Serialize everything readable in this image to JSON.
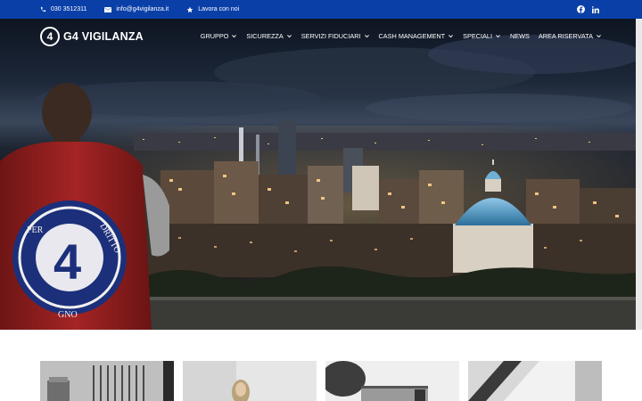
{
  "topbar": {
    "phone": "030 3512311",
    "email": "info@g4vigilanza.it",
    "jobs": "Lavora con noi",
    "social": [
      "facebook-icon",
      "linkedin-icon"
    ]
  },
  "header": {
    "logo_text": "G4 VIGILANZA",
    "nav": [
      {
        "label": "GRUPPO",
        "dropdown": true
      },
      {
        "label": "SICUREZZA",
        "dropdown": true
      },
      {
        "label": "SERVIZI FIDUCIARI",
        "dropdown": true
      },
      {
        "label": "CASH MANAGEMENT",
        "dropdown": true
      },
      {
        "label": "SPECIALI",
        "dropdown": true
      },
      {
        "label": "NEWS",
        "dropdown": false
      },
      {
        "label": "AREA RISERVATA",
        "dropdown": true
      }
    ]
  },
  "hero": {
    "cape_words_left": "PER",
    "cape_words_right": "DRITTO",
    "cape_words_bottom": "GNO"
  },
  "colors": {
    "topbar": "#0a3fa8",
    "cape": "#8e1d1d",
    "shield": "#1e3a8a"
  }
}
